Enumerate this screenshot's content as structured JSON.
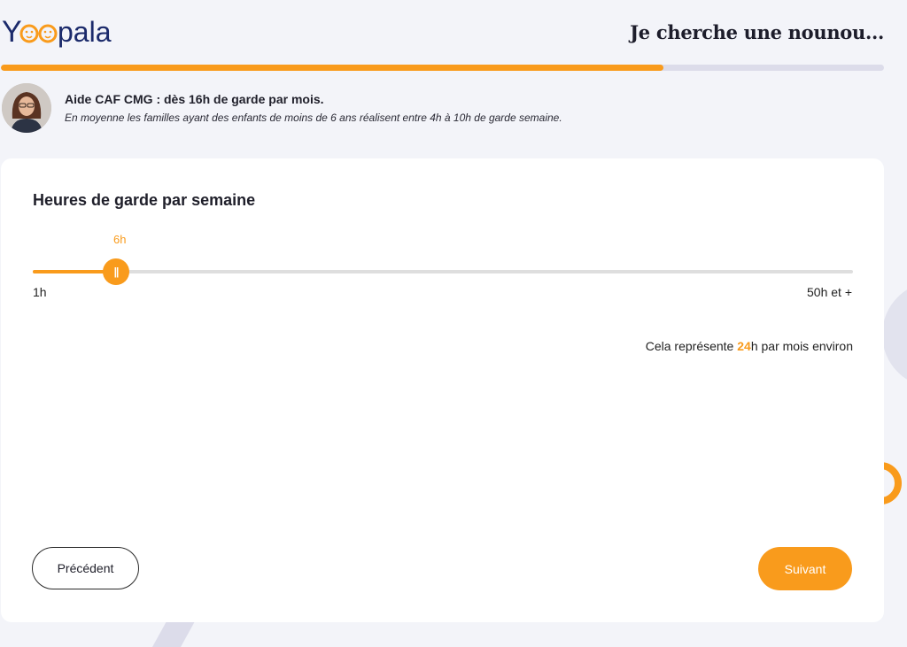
{
  "brand": {
    "logo_text": "Yoopala",
    "colors": {
      "accent": "#f99b1c",
      "navy": "#1b2a6b",
      "background": "#f3f4f9"
    }
  },
  "header": {
    "title": "Je cherche une nounou...",
    "progress_fraction": 0.75
  },
  "tip": {
    "avatar_icon": "advisor-avatar",
    "title": "Aide CAF CMG : dès 16h de garde par mois.",
    "text": "En moyenne les familles ayant des enfants de moins de 6 ans réalisent entre 4h à 10h de garde semaine."
  },
  "question": {
    "title": "Heures de garde par semaine",
    "slider": {
      "value_label": "6h",
      "value": 6,
      "min": 1,
      "max": 50,
      "min_label": "1h",
      "max_label": "50h et +",
      "thumb_glyph": "||"
    },
    "summary": {
      "prefix": "Cela représente ",
      "value": "24",
      "suffix": "h par mois environ"
    }
  },
  "navigation": {
    "prev_label": "Précédent",
    "next_label": "Suivant"
  }
}
